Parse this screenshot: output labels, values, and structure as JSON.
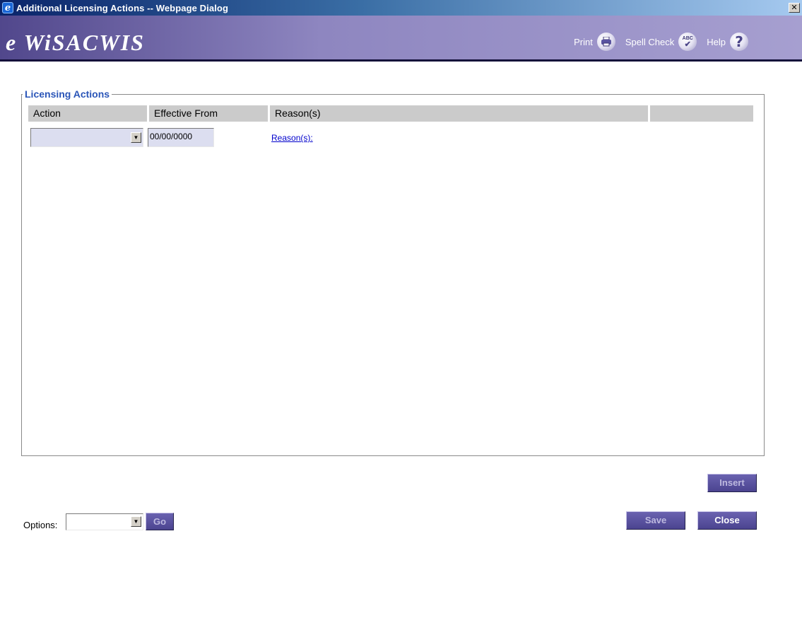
{
  "window": {
    "title": "Additional Licensing Actions -- Webpage Dialog",
    "close_glyph": "✕"
  },
  "banner": {
    "logo": "e WiSACWIS",
    "print_label": "Print",
    "spellcheck_label": "Spell Check",
    "spellcheck_icon_text": "ABC",
    "help_label": "Help",
    "help_icon_text": "?"
  },
  "licensing": {
    "legend": "Licensing Actions",
    "columns": [
      "Action",
      "Effective From",
      "Reason(s)",
      ""
    ],
    "rows": [
      {
        "action_value": "",
        "effective_from": "00/00/0000",
        "reasons_link": "Reason(s):"
      }
    ]
  },
  "buttons": {
    "insert": "Insert",
    "save": "Save",
    "close": "Close",
    "go": "Go"
  },
  "options": {
    "label": "Options:",
    "selected": ""
  },
  "colors": {
    "banner_start": "#51478c",
    "banner_end": "#a69fd0",
    "legend_text": "#2a55b8",
    "button": "#5a52a0",
    "link": "#0000cc"
  }
}
